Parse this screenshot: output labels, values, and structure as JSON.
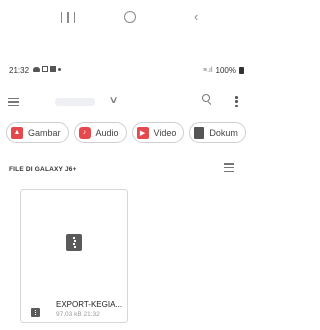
{
  "status_bar": {
    "time": "21:32",
    "battery": "100%"
  },
  "toolbar": {
    "location_label": ""
  },
  "chips": [
    {
      "label": "Gambar",
      "icon": "image-icon"
    },
    {
      "label": "Audio",
      "icon": "audio-icon"
    },
    {
      "label": "Video",
      "icon": "video-icon"
    },
    {
      "label": "Dokum",
      "icon": "document-icon"
    }
  ],
  "section": {
    "title": "FILE DI GALAXY J6+"
  },
  "files": [
    {
      "name": "EXPORT-KEGIA...",
      "size": "97,03 kB",
      "time": "21:32",
      "meta": "97,03 kB 21:32",
      "icon": "zip-icon"
    }
  ],
  "colors": {
    "chip_icon": "#e5484d",
    "border": "#d7d7d7",
    "muted_text": "#999999"
  }
}
